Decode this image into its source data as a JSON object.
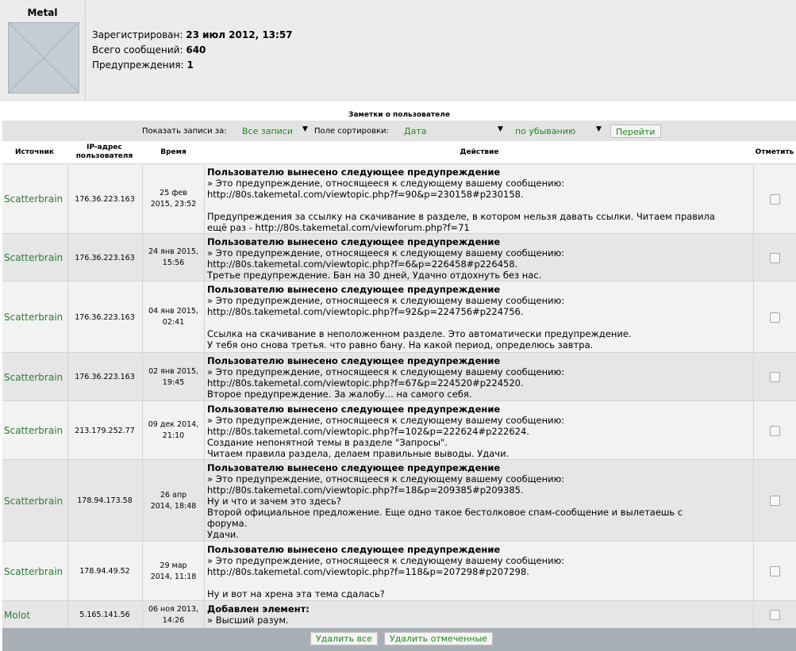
{
  "profile": {
    "username": "Metal",
    "fields": [
      {
        "label": "Зарегистрирован:",
        "value": "23 июл 2012, 13:57"
      },
      {
        "label": "Всего сообщений:",
        "value": "640"
      },
      {
        "label": "Предупреждения:",
        "value": "1"
      }
    ]
  },
  "notes": {
    "title": "Заметки о пользователе",
    "filter": {
      "show_label": "Показать записи за:",
      "show_value": "Все записи",
      "sort_label": "Поле сортировки:",
      "sort_field": "Дата",
      "sort_dir": "по убыванию",
      "go_label": "Перейти"
    },
    "columns": {
      "source": "Источник",
      "ip": "IP-адрес пользователя",
      "time": "Время",
      "action": "Действие",
      "mark": "Отметить"
    },
    "rows": [
      {
        "source": "Scatterbrain",
        "ip": "176.36.223.163",
        "time1": "25 фев",
        "time2": "2015, 23:52",
        "title": "Пользователю вынесено следующее предупреждение",
        "body": "» Это предупреждение, относящееся к следующему вашему сообщению:\nhttp://80s.takemetal.com/viewtopic.php?f=90&p=230158#p230158.\n\nПредупреждения за ссылку на скачивание в разделе, в котором нельзя давать ссылки. Читаем правила\nещё раз - http://80s.takemetal.com/viewforum.php?f=71"
      },
      {
        "source": "Scatterbrain",
        "ip": "176.36.223.163",
        "time1": "24 янв 2015,",
        "time2": "15:56",
        "title": "Пользователю вынесено следующее предупреждение",
        "body": "» Это предупреждение, относящееся к следующему вашему сообщению:\nhttp://80s.takemetal.com/viewtopic.php?f=6&p=226458#p226458.\nТретье предупреждение. Бан на 30 дней, Удачно отдохнуть без нас."
      },
      {
        "source": "Scatterbrain",
        "ip": "176.36.223.163",
        "time1": "04 янв 2015,",
        "time2": "02:41",
        "title": "Пользователю вынесено следующее предупреждение",
        "body": "» Это предупреждение, относящееся к следующему вашему сообщению:\nhttp://80s.takemetal.com/viewtopic.php?f=92&p=224756#p224756.\n\nСсылка на скачивание в неположенном разделе. Это автоматически предупреждение.\nУ тебя оно снова третья. что равно бану. На какой период, определюсь завтра."
      },
      {
        "source": "Scatterbrain",
        "ip": "176.36.223.163",
        "time1": "02 янв 2015,",
        "time2": "19:45",
        "title": "Пользователю вынесено следующее предупреждение",
        "body": "» Это предупреждение, относящееся к следующему вашему сообщению:\nhttp://80s.takemetal.com/viewtopic.php?f=67&p=224520#p224520.\nВторое предупреждение. За жалобу... на самого себя."
      },
      {
        "source": "Scatterbrain",
        "ip": "213.179.252.77",
        "time1": "09 дек 2014,",
        "time2": "21:10",
        "title": "Пользователю вынесено следующее предупреждение",
        "body": "» Это предупреждение, относящееся к следующему вашему сообщению:\nhttp://80s.takemetal.com/viewtopic.php?f=102&p=222624#p222624.\nСоздание непонятной темы в разделе \"Запросы\".\nЧитаем правила раздела, делаем правильные выводы. Удачи."
      },
      {
        "source": "Scatterbrain",
        "ip": "178.94.173.58",
        "time1": "26 апр",
        "time2": "2014, 18:48",
        "title": "Пользователю вынесено следующее предупреждение",
        "body": "» Это предупреждение, относящееся к следующему вашему сообщению:\nhttp://80s.takemetal.com/viewtopic.php?f=18&p=209385#p209385.\nНу и что и зачем это здесь?\nВторой официальное предложение. Еще одно такое бестолковое спам-сообщение и вылетаешь с\nфорума.\nУдачи."
      },
      {
        "source": "Scatterbrain",
        "ip": "178.94.49.52",
        "time1": "29 мар",
        "time2": "2014, 11:18",
        "title": "Пользователю вынесено следующее предупреждение",
        "body": "» Это предупреждение, относящееся к следующему вашему сообщению:\nhttp://80s.takemetal.com/viewtopic.php?f=118&p=207298#p207298.\n\nНу и вот на хрена эта тема сдалась?"
      },
      {
        "source": "Molot",
        "ip": "5.165.141.56",
        "time1": "06 ноя 2013,",
        "time2": "14:26",
        "title": "Добавлен элемент:",
        "body": "» Высший разум."
      }
    ],
    "buttons": {
      "delete_all": "Удалить все",
      "delete_marked": "Удалить отмеченные"
    }
  }
}
